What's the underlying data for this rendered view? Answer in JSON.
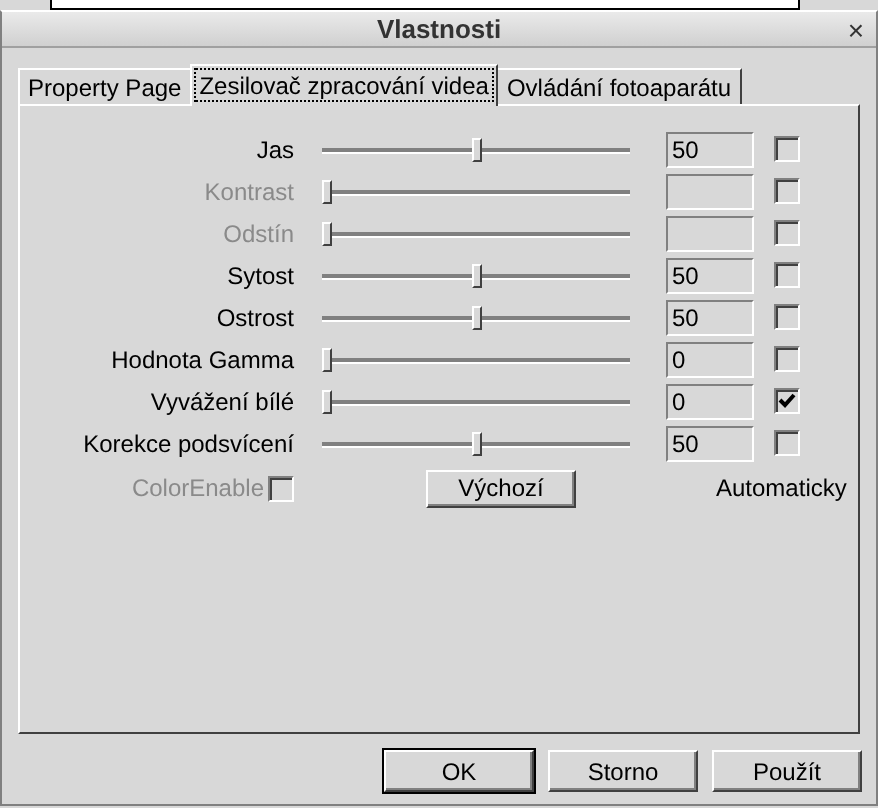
{
  "window": {
    "title": "Vlastnosti",
    "close": "×"
  },
  "tabs": [
    {
      "label": "Property Page",
      "selected": false
    },
    {
      "label": "Zesilovač zpracování videa",
      "selected": true
    },
    {
      "label": "Ovládání fotoaparátu",
      "selected": false
    }
  ],
  "rows": [
    {
      "label": "Jas",
      "disabled": false,
      "level": 0.5,
      "value": "50",
      "auto_checked": false
    },
    {
      "label": "Kontrast",
      "disabled": true,
      "level": 0,
      "auto_checked": false
    },
    {
      "label": "Odstín",
      "disabled": true,
      "level": 0,
      "auto_checked": false
    },
    {
      "label": "Sytost",
      "disabled": false,
      "level": 0.5,
      "value": "50",
      "auto_checked": false
    },
    {
      "label": "Ostrost",
      "disabled": false,
      "level": 0.5,
      "value": "50",
      "auto_checked": false
    },
    {
      "label": "Hodnota Gamma",
      "disabled": false,
      "level": 0,
      "value": "0",
      "auto_checked": false
    },
    {
      "label": "Vyvážení bílé",
      "disabled": false,
      "level": 0,
      "value": "0",
      "auto_checked": true
    },
    {
      "label": "Korekce podsvícení",
      "disabled": false,
      "level": 0.5,
      "value": "50",
      "auto_checked": false
    }
  ],
  "color_enable": {
    "label": "ColorEnable",
    "disabled": true,
    "checked": false
  },
  "default_button": "Výchozí",
  "auto_label": "Automaticky",
  "buttons": [
    {
      "label": "OK",
      "default": true
    },
    {
      "label": "Storno",
      "default": false
    },
    {
      "label": "Použít",
      "default": false
    }
  ]
}
